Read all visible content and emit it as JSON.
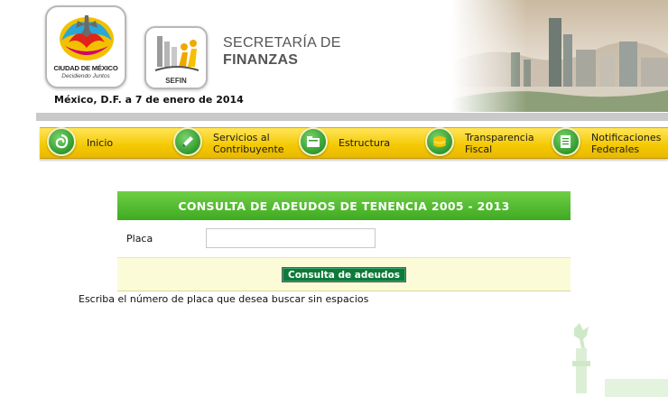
{
  "header": {
    "cdmx_logo": {
      "name": "CIUDAD DE MÉXICO",
      "slogan": "Decidiendo Juntos",
      "icon": "angel-independencia-icon"
    },
    "sefin_logo": {
      "label": "SEFIN",
      "icon": "sefin-emblem-icon"
    },
    "department_line1": "SECRETARÍA DE",
    "department_line2": "FINANZAS",
    "date": "México, D.F. a 7 de enero de 2014"
  },
  "nav": {
    "items": [
      {
        "label": "Inicio",
        "icon": "home-spiral-icon"
      },
      {
        "label": "Servicios al\nContribuyente",
        "icon": "pencil-icon"
      },
      {
        "label": "Estructura",
        "icon": "folders-icon"
      },
      {
        "label": "Transparencia\nFiscal",
        "icon": "coins-icon"
      },
      {
        "label": "Notificaciones\nFederales",
        "icon": "documents-icon"
      }
    ]
  },
  "form": {
    "title": "CONSULTA DE ADEUDOS DE TENENCIA 2005 - 2013",
    "placa_label": "Placa",
    "placa_value": "",
    "placa_placeholder": "",
    "submit_label": "Consulta de adeudos",
    "help_text": "Escriba el número de placa que desea buscar sin espacios"
  },
  "colors": {
    "nav_yellow": "#f4c800",
    "panel_green": "#4cb82c",
    "button_green": "#0d7a3a",
    "button_row_bg": "#fbfbd8"
  }
}
